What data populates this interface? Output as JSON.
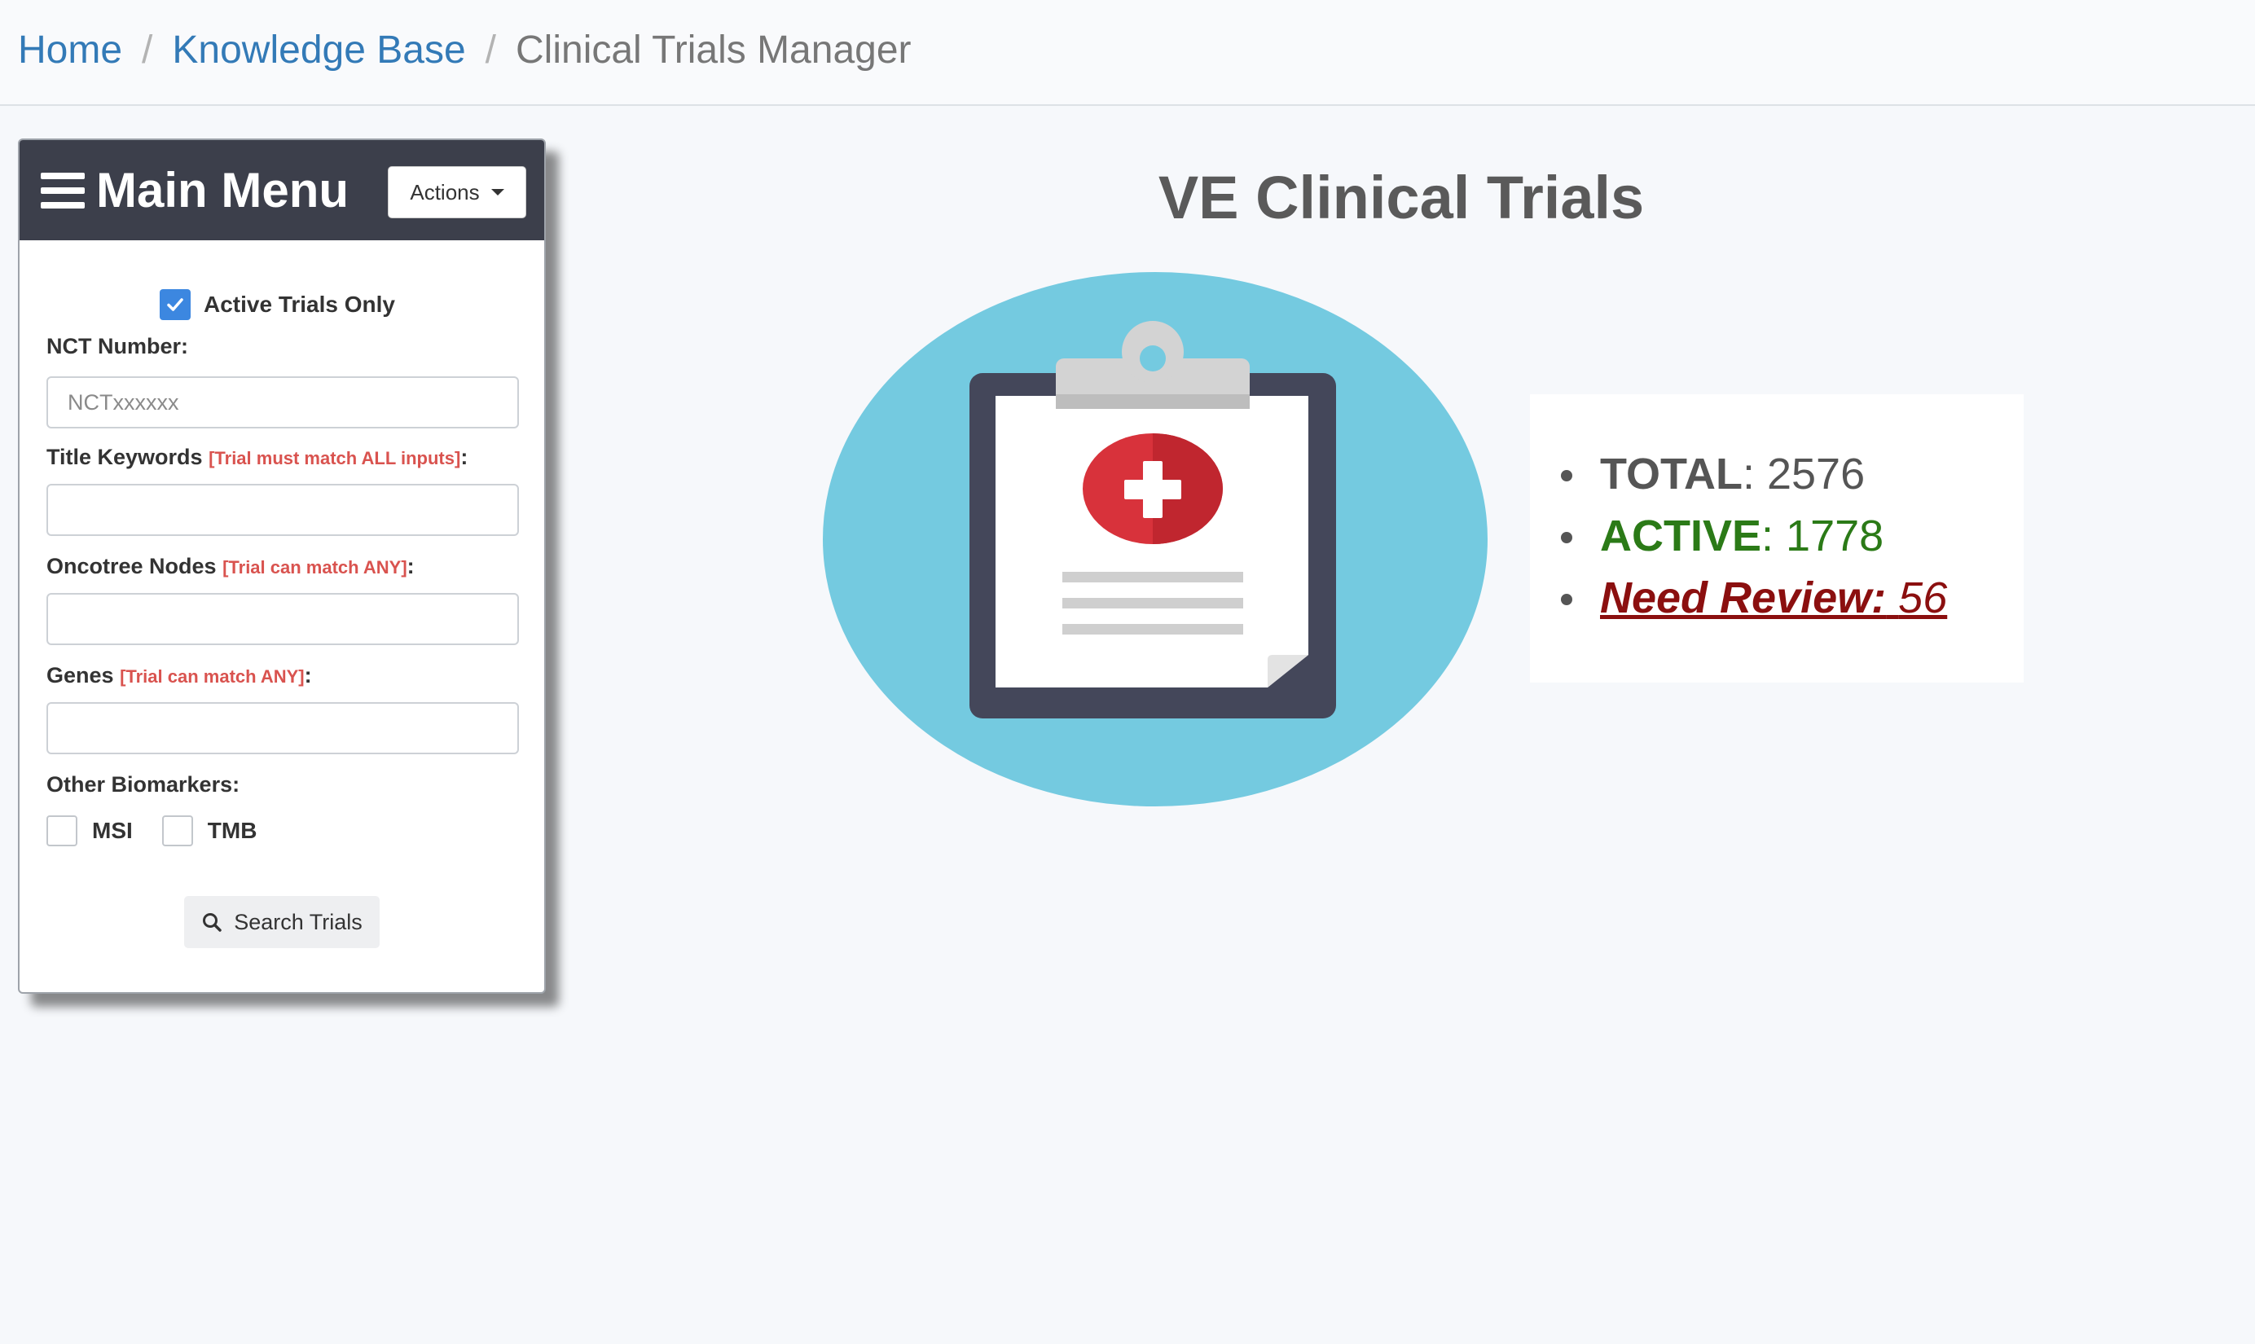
{
  "breadcrumb": {
    "home": "Home",
    "separator": "/",
    "knowledge_base": "Knowledge Base",
    "current": "Clinical Trials Manager"
  },
  "menu": {
    "title": "Main Menu",
    "actions_label": "Actions",
    "active_only_label": "Active Trials Only",
    "active_only_checked": true,
    "nct_label": "NCT Number:",
    "nct_placeholder": "NCTxxxxxx",
    "nct_value": "",
    "title_keywords_label": "Title Keywords",
    "title_keywords_hint": "[Trial must match ALL inputs]",
    "oncotree_label": "Oncotree Nodes",
    "oncotree_hint": "[Trial can match ANY]",
    "genes_label": "Genes",
    "genes_hint": "[Trial can match ANY]",
    "colon": ":",
    "biomarkers_label": "Other Biomarkers:",
    "msi_label": "MSI",
    "msi_checked": false,
    "tmb_label": "TMB",
    "tmb_checked": false,
    "search_label": "Search Trials"
  },
  "main": {
    "title": "VE Clinical Trials",
    "stats": {
      "total_label": "TOTAL",
      "total_value": ": 2576",
      "active_label": "ACTIVE",
      "active_value": ": 1778",
      "review_label": "Need Review:",
      "review_value": "56"
    }
  },
  "colors": {
    "breadcrumb_link": "#337ab7",
    "menu_header": "#3c3f4b",
    "checkbox_accent": "#3c87e0",
    "hint_red": "#d9534f",
    "active_green": "#2b7a17",
    "review_red": "#8b0f0f",
    "illustration_circle": "#74cae0"
  },
  "icons": {
    "menu": "hamburger-icon",
    "actions": "caret-down-icon",
    "search": "search-icon",
    "illustration": "medical-clipboard-icon"
  }
}
